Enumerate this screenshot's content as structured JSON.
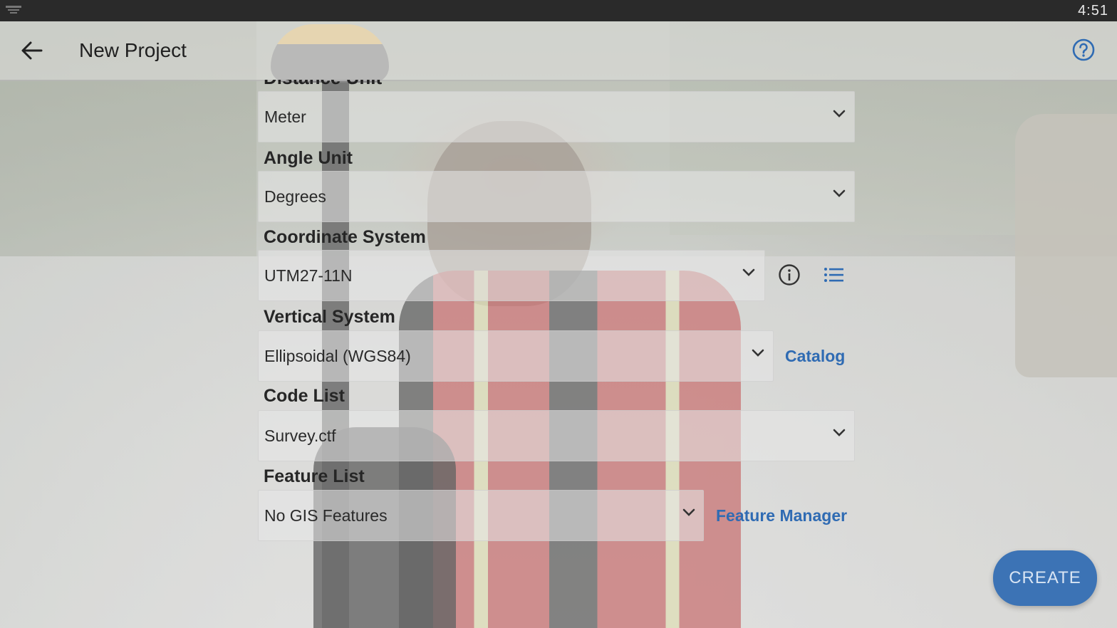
{
  "status_bar": {
    "time": "4:51"
  },
  "app_bar": {
    "title": "New Project"
  },
  "form": {
    "distance_unit": {
      "label": "Distance Unit",
      "value": "Meter"
    },
    "angle_unit": {
      "label": "Angle Unit",
      "value": "Degrees"
    },
    "coordinate_system": {
      "label": "Coordinate System",
      "value": "UTM27-11N"
    },
    "vertical_system": {
      "label": "Vertical System",
      "value": "Ellipsoidal (WGS84)",
      "link": "Catalog"
    },
    "code_list": {
      "label": "Code List",
      "value": "Survey.ctf"
    },
    "feature_list": {
      "label": "Feature List",
      "value": "No GIS Features",
      "link": "Feature Manager"
    }
  },
  "actions": {
    "create": "CREATE"
  },
  "colors": {
    "accent": "#2f6bb3",
    "status_bar": "#2a2a2a"
  },
  "icons": [
    "back-arrow-icon",
    "help-icon",
    "chevron-down-icon",
    "info-icon",
    "list-icon",
    "notification-icon"
  ]
}
